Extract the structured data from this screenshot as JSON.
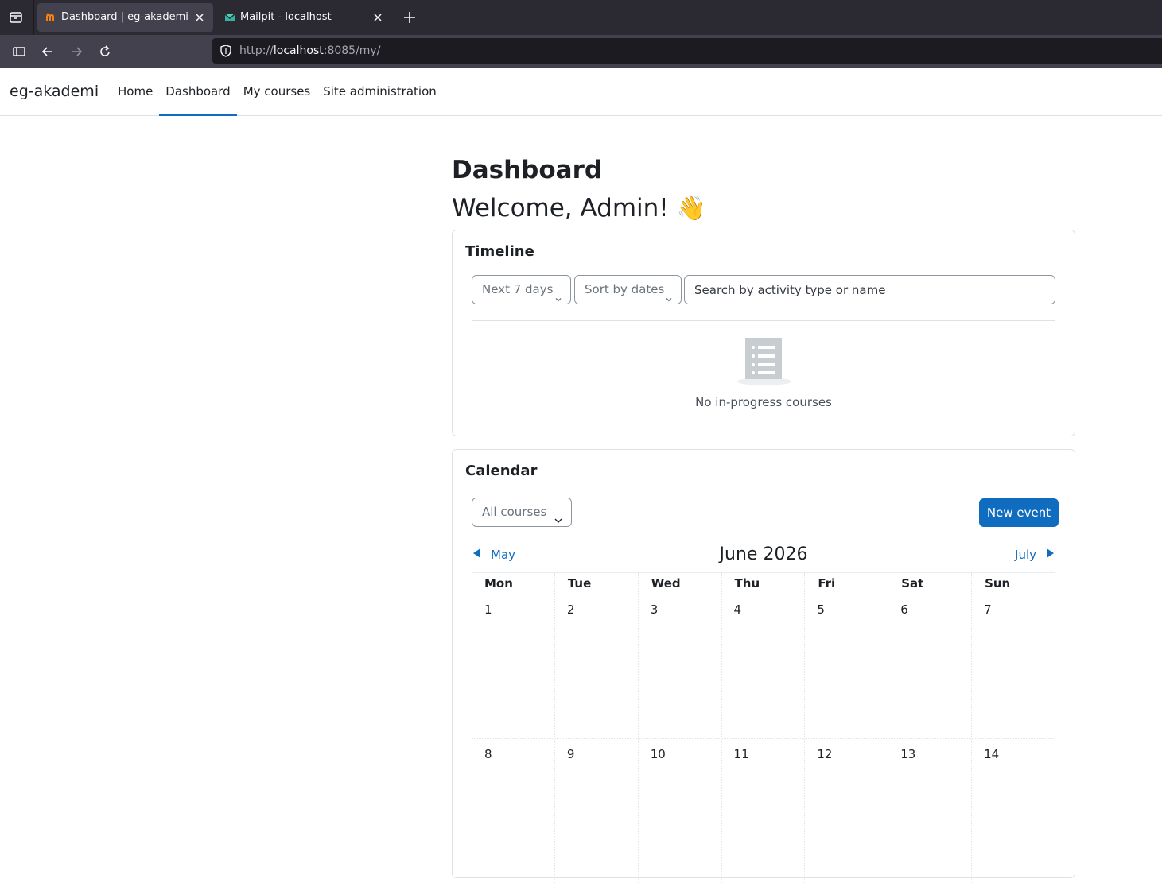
{
  "browser": {
    "tabs": [
      {
        "title": "Dashboard | eg-akademi",
        "active": true
      },
      {
        "title": "Mailpit - localhost",
        "active": false
      }
    ],
    "url": {
      "scheme": "http://",
      "host": "localhost",
      "rest": ":8085/my/"
    }
  },
  "site": {
    "brand": "eg-akademi",
    "nav": [
      "Home",
      "Dashboard",
      "My courses",
      "Site administration"
    ],
    "active_nav": "Dashboard"
  },
  "page": {
    "title": "Dashboard",
    "welcome": "Welcome, Admin!",
    "welcome_emoji": "👋"
  },
  "timeline": {
    "title": "Timeline",
    "filter_label": "Next 7 days",
    "sort_label": "Sort by dates",
    "search_placeholder": "Search by activity type or name",
    "empty_text": "No in-progress courses"
  },
  "calendar": {
    "title": "Calendar",
    "course_filter": "All courses",
    "new_event_label": "New event",
    "prev_month": "May",
    "current_month": "June 2026",
    "next_month": "July",
    "weekdays": [
      "Mon",
      "Tue",
      "Wed",
      "Thu",
      "Fri",
      "Sat",
      "Sun"
    ],
    "weeks": [
      [
        "1",
        "2",
        "3",
        "4",
        "5",
        "6",
        "7"
      ],
      [
        "8",
        "9",
        "10",
        "11",
        "12",
        "13",
        "14"
      ]
    ]
  },
  "colors": {
    "accent": "#0f6cbf",
    "chrome_dark": "#2b2a33",
    "chrome_mid": "#42414d"
  }
}
